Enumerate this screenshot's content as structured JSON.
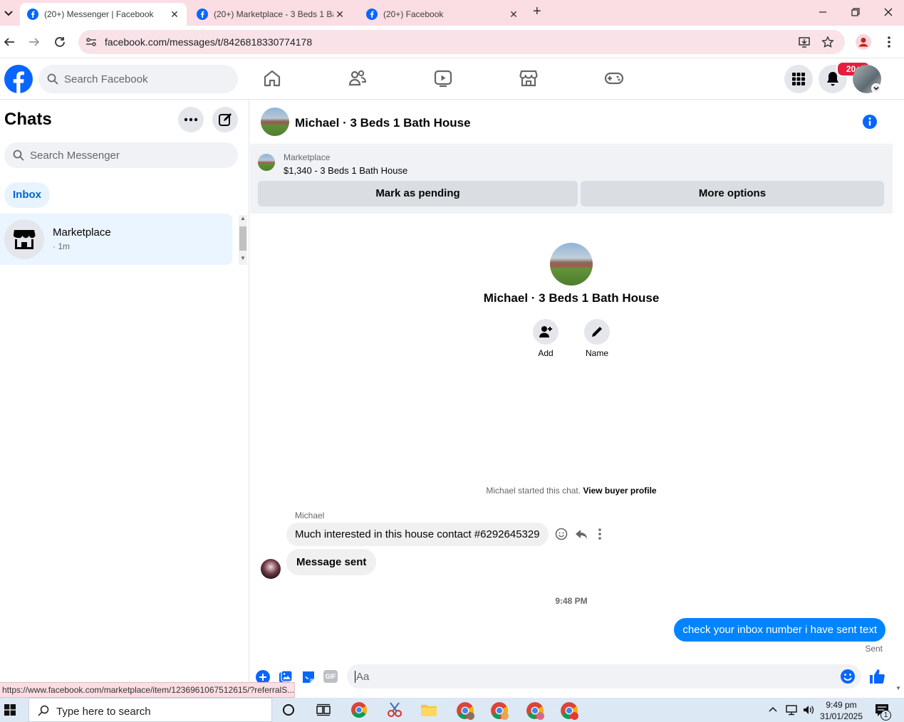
{
  "browser": {
    "tabs": [
      {
        "title": "(20+) Messenger | Facebook",
        "active": true
      },
      {
        "title": "(20+) Marketplace - 3 Beds 1 Ba",
        "active": false
      },
      {
        "title": "(20+) Facebook",
        "active": false
      }
    ],
    "url": "facebook.com/messages/t/8426818330774178",
    "status_url": "https://www.facebook.com/marketplace/item/1236961067512615/?referralS..."
  },
  "fb_header": {
    "search_placeholder": "Search Facebook",
    "notification_badge": "20+"
  },
  "sidebar": {
    "title": "Chats",
    "search_placeholder": "Search Messenger",
    "filter_chip": "Inbox",
    "chats": [
      {
        "name": "Marketplace",
        "meta": "· 1m"
      }
    ]
  },
  "conversation": {
    "title": "Michael · 3 Beds 1 Bath House",
    "listing": {
      "source": "Marketplace",
      "summary": "$1,340 - 3 Beds 1 Bath House",
      "btn_pending": "Mark as pending",
      "btn_more": "More options"
    },
    "profile": {
      "name": "Michael · 3 Beds 1 Bath House",
      "add_label": "Add",
      "name_label": "Name"
    },
    "started_text": "Michael started this chat.",
    "view_profile": "View buyer profile",
    "sender_name": "Michael",
    "messages_in": [
      "Much interested in this house contact #6292645329",
      "Message sent"
    ],
    "timestamp": "9:48 PM",
    "message_out": "check your inbox number i have sent text",
    "sent_status": "Sent",
    "composer_placeholder": "Aa",
    "gif_label": "GIF"
  },
  "taskbar": {
    "search_placeholder": "Type here to search",
    "time": "9:49 pm",
    "date": "31/01/2025",
    "notif_count": "1"
  },
  "colors": {
    "fb_blue": "#0866ff",
    "messenger_blue": "#0084ff",
    "badge_red": "#e41e3f",
    "tab_pink": "#fbdde4"
  }
}
